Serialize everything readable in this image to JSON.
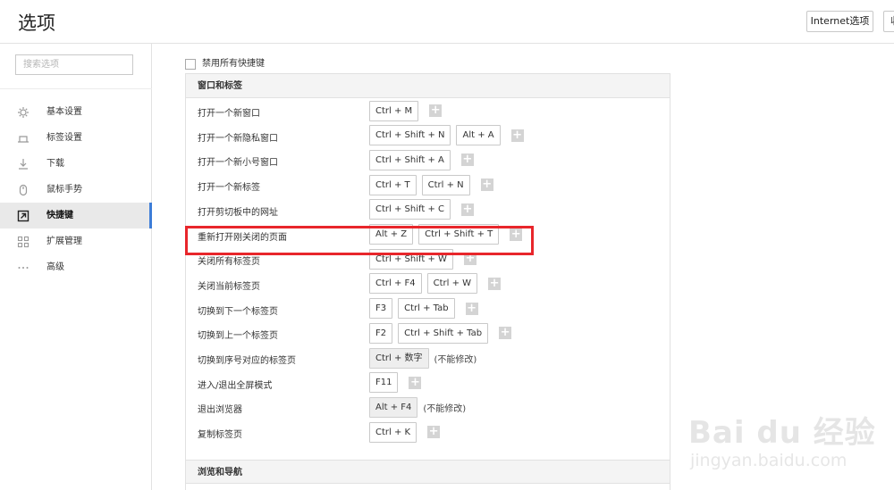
{
  "header": {
    "title": "选项",
    "internet_options_label": "Internet选项",
    "extra_button_label": "收"
  },
  "sidebar": {
    "search_placeholder": "搜索选项",
    "items": [
      {
        "label": "基本设置",
        "icon": "gear-icon",
        "active": false
      },
      {
        "label": "标签设置",
        "icon": "tab-icon",
        "active": false
      },
      {
        "label": "下载",
        "icon": "download-icon",
        "active": false
      },
      {
        "label": "鼠标手势",
        "icon": "mouse-icon",
        "active": false
      },
      {
        "label": "快捷键",
        "icon": "shortcut-icon",
        "active": true
      },
      {
        "label": "扩展管理",
        "icon": "extensions-icon",
        "active": false
      },
      {
        "label": "高级",
        "icon": "more-icon",
        "active": false
      }
    ]
  },
  "main": {
    "disable_all_label": "禁用所有快捷键",
    "disable_all_checked": false,
    "section_window_tabs": "窗口和标签",
    "section_browse_nav": "浏览和导航",
    "shortcuts": [
      {
        "label": "打开一个新窗口",
        "keys": [
          "Ctrl + M"
        ],
        "fixed": false,
        "note": ""
      },
      {
        "label": "打开一个新隐私窗口",
        "keys": [
          "Ctrl + Shift + N",
          "Alt + A"
        ],
        "fixed": false,
        "note": ""
      },
      {
        "label": "打开一个新小号窗口",
        "keys": [
          "Ctrl + Shift + A"
        ],
        "fixed": false,
        "note": ""
      },
      {
        "label": "打开一个新标签",
        "keys": [
          "Ctrl + T",
          "Ctrl + N"
        ],
        "fixed": false,
        "note": ""
      },
      {
        "label": "打开剪切板中的网址",
        "keys": [
          "Ctrl + Shift + C"
        ],
        "fixed": false,
        "note": ""
      },
      {
        "label": "重新打开刚关闭的页面",
        "keys": [
          "Alt + Z",
          "Ctrl + Shift + T"
        ],
        "fixed": false,
        "note": ""
      },
      {
        "label": "关闭所有标签页",
        "keys": [
          "Ctrl + Shift + W"
        ],
        "fixed": false,
        "note": ""
      },
      {
        "label": "关闭当前标签页",
        "keys": [
          "Ctrl + F4",
          "Ctrl + W"
        ],
        "fixed": false,
        "note": ""
      },
      {
        "label": "切换到下一个标签页",
        "keys": [
          "F3",
          "Ctrl + Tab"
        ],
        "fixed": false,
        "note": ""
      },
      {
        "label": "切换到上一个标签页",
        "keys": [
          "F2",
          "Ctrl + Shift + Tab"
        ],
        "fixed": false,
        "note": ""
      },
      {
        "label": "切换到序号对应的标签页",
        "keys": [
          "Ctrl + 数字"
        ],
        "fixed": true,
        "note": "(不能修改)"
      },
      {
        "label": "进入/退出全屏模式",
        "keys": [
          "F11"
        ],
        "fixed": false,
        "note": ""
      },
      {
        "label": "退出浏览器",
        "keys": [
          "Alt + F4"
        ],
        "fixed": true,
        "note": "(不能修改)"
      },
      {
        "label": "复制标签页",
        "keys": [
          "Ctrl + K"
        ],
        "fixed": false,
        "note": ""
      }
    ],
    "highlighted_row": "重新打开刚关闭的页面",
    "highlight_color": "#e8262b"
  },
  "watermark": {
    "text": "Bai du 经验",
    "url": "jingyan.baidu.com"
  },
  "colors": {
    "accent": "#3d7dd8",
    "highlight": "#e8262b"
  }
}
